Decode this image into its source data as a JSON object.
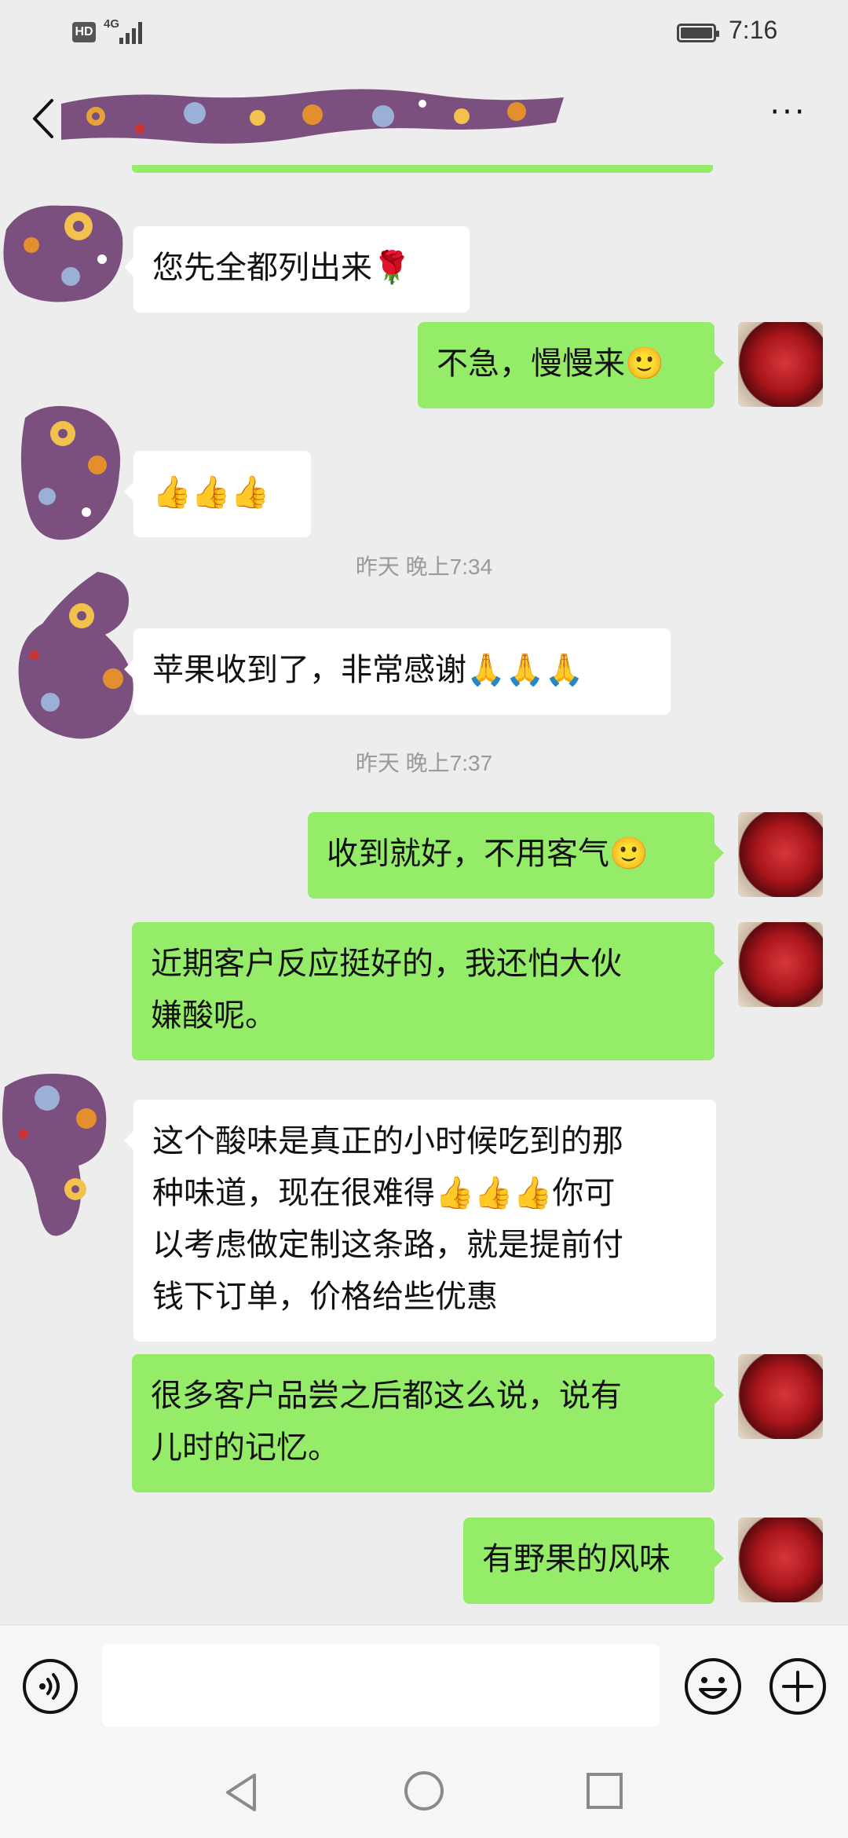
{
  "status_bar": {
    "hd": "HD",
    "network": "4G",
    "time": "7:16",
    "icons": [
      "hd-badge-icon",
      "signal-icon",
      "battery-icon"
    ]
  },
  "header": {
    "back_icon": "chevron-left-icon",
    "title_redacted": true,
    "more_icon": "more-dots-icon",
    "more_label": "···"
  },
  "colors": {
    "incoming_bubble": "#ffffff",
    "outgoing_bubble": "#95ec69",
    "background": "#ededed",
    "timestamp": "#9a9a9a"
  },
  "messages": [
    {
      "side": "in",
      "text": "您先全都列出来🌹"
    },
    {
      "side": "out",
      "text": "不急，慢慢来🙂"
    },
    {
      "side": "in",
      "text": "👍👍👍"
    },
    {
      "type": "time",
      "text": "昨天 晚上7:34"
    },
    {
      "side": "in",
      "text": "苹果收到了，非常感谢🙏🙏🙏"
    },
    {
      "type": "time",
      "text": "昨天 晚上7:37"
    },
    {
      "side": "out",
      "text": "收到就好，不用客气🙂"
    },
    {
      "side": "out",
      "lines": [
        "近期客户反应挺好的，我还怕大伙",
        "嫌酸呢。"
      ]
    },
    {
      "side": "in",
      "lines": [
        "这个酸味是真正的小时候吃到的那",
        "种味道，现在很难得👍👍👍你可",
        "以考虑做定制这条路，就是提前付",
        "钱下订单，价格给些优惠"
      ]
    },
    {
      "side": "out",
      "lines": [
        "很多客户品尝之后都这么说，说有",
        "儿时的记忆。"
      ]
    },
    {
      "side": "out",
      "text": "有野果的风味"
    }
  ],
  "input_bar": {
    "voice_icon": "voice-icon",
    "emoji_icon": "emoji-icon",
    "plus_icon": "plus-icon",
    "input_value": ""
  },
  "nav_bar": {
    "icons": [
      "nav-back-icon",
      "nav-home-icon",
      "nav-recent-icon"
    ]
  }
}
